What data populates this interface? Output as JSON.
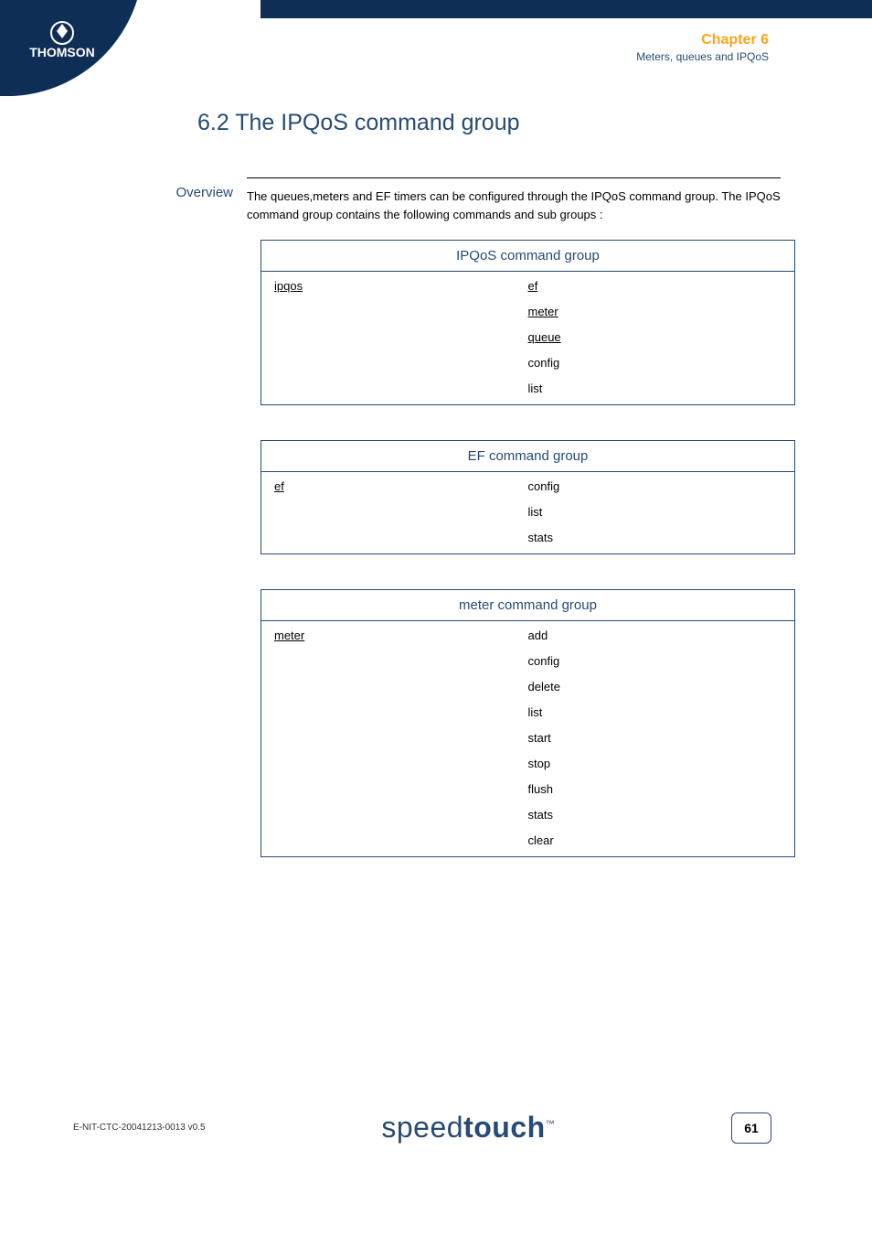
{
  "header": {
    "chapter": "Chapter 6",
    "subtitle": "Meters, queues and IPQoS"
  },
  "logo": {
    "brand": "THOMSON"
  },
  "section": {
    "number_title": "6.2  The IPQoS command group",
    "overview_label": "Overview",
    "overview_text": "The queues,meters and EF timers can be configured through the IPQoS command group. The IPQoS command group contains the following commands and sub groups :"
  },
  "groups": [
    {
      "title": "IPQoS command group",
      "left": [
        {
          "text": "ipqos",
          "link": true
        }
      ],
      "right": [
        {
          "text": "ef",
          "link": true
        },
        {
          "text": "meter",
          "link": true
        },
        {
          "text": "queue",
          "link": true
        },
        {
          "text": "config",
          "link": false
        },
        {
          "text": "list",
          "link": false
        }
      ]
    },
    {
      "title": "EF command group",
      "left": [
        {
          "text": "ef",
          "link": true
        }
      ],
      "right": [
        {
          "text": "config",
          "link": false
        },
        {
          "text": "list",
          "link": false
        },
        {
          "text": "stats",
          "link": false
        }
      ]
    },
    {
      "title": "meter command group",
      "left": [
        {
          "text": "meter",
          "link": true
        }
      ],
      "right": [
        {
          "text": "add",
          "link": false
        },
        {
          "text": "config",
          "link": false
        },
        {
          "text": "delete",
          "link": false
        },
        {
          "text": "list",
          "link": false
        },
        {
          "text": "start",
          "link": false
        },
        {
          "text": "stop",
          "link": false
        },
        {
          "text": "flush",
          "link": false
        },
        {
          "text": "stats",
          "link": false
        },
        {
          "text": "clear",
          "link": false
        }
      ]
    }
  ],
  "footer": {
    "code": "E-NIT-CTC-20041213-0013 v0.5",
    "brand_light": "speed",
    "brand_bold": "touch",
    "brand_tm": "™",
    "page": "61"
  }
}
